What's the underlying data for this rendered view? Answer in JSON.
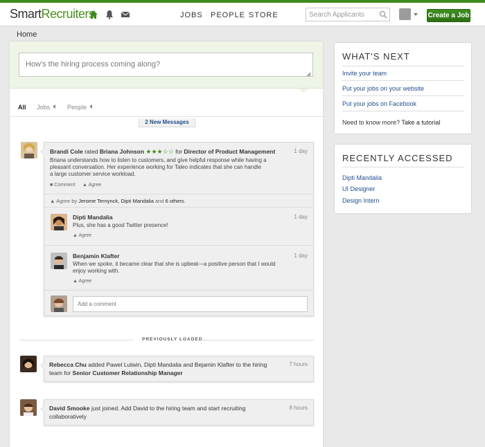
{
  "brand": {
    "part1": "Smart",
    "part2": "Recruiters"
  },
  "header": {
    "nav": [
      "JOBS",
      "PEOPLE",
      "STORE"
    ],
    "search_placeholder": "Search Applicants",
    "create_job": "Create a Job",
    "accent": "#3f8a1d"
  },
  "breadcrumb": "Home",
  "composer": {
    "placeholder": "How's the hiring process coming along?"
  },
  "filters": {
    "all": "All",
    "jobs": "Jobs",
    "people": "People"
  },
  "new_messages": "2 New Messages",
  "feed": {
    "item1": {
      "actor": "Brandi Cole",
      "verb": " rated ",
      "subject": "Briana Johnson",
      "stars": "★★★☆☆",
      "for_text": " for ",
      "job": "Director of Product Management",
      "time": "1 day",
      "body_lines": [
        "Briana understands how to listen to customers, and give helpful response while having a",
        "pleasant conversation. Her experience working for Taleo indicates that she can handle",
        "a large customer service workload."
      ],
      "comment_label": "Comment",
      "agree_label": "Agree",
      "agreed_by_prefix": "Agree by ",
      "agreed_names": "Jerome Ternynck, Dipti Mandalia",
      "agreed_and": " and ",
      "agreed_others": "6 others",
      "agreed_end": ".",
      "comments": [
        {
          "name": "Dipti Mandalia",
          "time": "1 day",
          "lines": [
            "Plus, she has a good Twitter presence!"
          ],
          "agree": "Agree"
        },
        {
          "name": "Benjamin Klafter",
          "time": "1 day",
          "lines": [
            "When we spoke, it became clear that she is upbeat—a positive person that I would",
            "enjoy working with."
          ],
          "agree": "Agree"
        }
      ],
      "add_comment_placeholder": "Add a comment"
    },
    "divider": "PREVIOUSLY LOADED",
    "item2": {
      "actor": "Rebecca Chu",
      "text1": " added Pawel Lutwin, Dipti Mandalia and Bejamin Klafter to the hiring",
      "text2": "team for ",
      "job": "Senior Customer Relationship Manager",
      "time": "7 hours"
    },
    "item3": {
      "actor": "David Smooke",
      "text1": " just joined. Add David to the hiring team and start recruiting",
      "text2": "collaboratively",
      "time": "8 hours"
    }
  },
  "whats_next": {
    "title": "WHAT'S NEXT",
    "links": [
      "Invite your team",
      "Put your jobs on your website",
      "Put your jobs on Facebook"
    ],
    "help_text": "Need to know more? ",
    "help_link": "Take a tutorial"
  },
  "recent": {
    "title": "RECENTLY ACCESSED",
    "links": [
      "Dipti Mandalia",
      "UI Designer",
      "Design Intern"
    ]
  }
}
